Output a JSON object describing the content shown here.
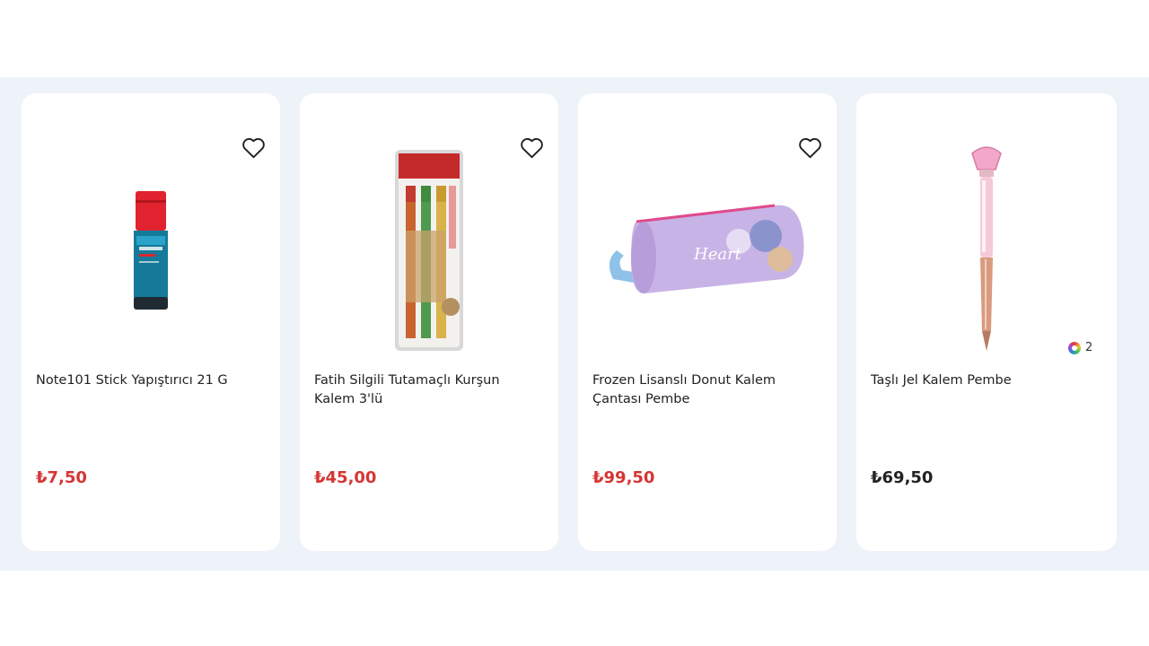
{
  "products": [
    {
      "title": "Note101 Stick Yapıştırıcı 21 G",
      "price": "₺7,50",
      "image": "glue-stick-image"
    },
    {
      "title": "Fatih Silgili Tutamaçlı Kurşun Kalem 3'lü",
      "price": "₺45,00",
      "image": "pencil-pack-image"
    },
    {
      "title": "Frozen Lisanslı Donut Kalem Çantası Pembe",
      "price": "₺99,50",
      "image": "pencil-case-image",
      "product_text": "Heart"
    },
    {
      "title": "Taşlı Jel Kalem Pembe",
      "price": "₺69,50",
      "image": "gel-pen-image",
      "variant_count": "2"
    }
  ],
  "colors": {
    "price_red": "#d63535",
    "price_dark": "#222222",
    "band": "#eef3f9"
  },
  "icons": {
    "favorite": "heart-outline-icon",
    "variants": "color-wheel-icon"
  }
}
